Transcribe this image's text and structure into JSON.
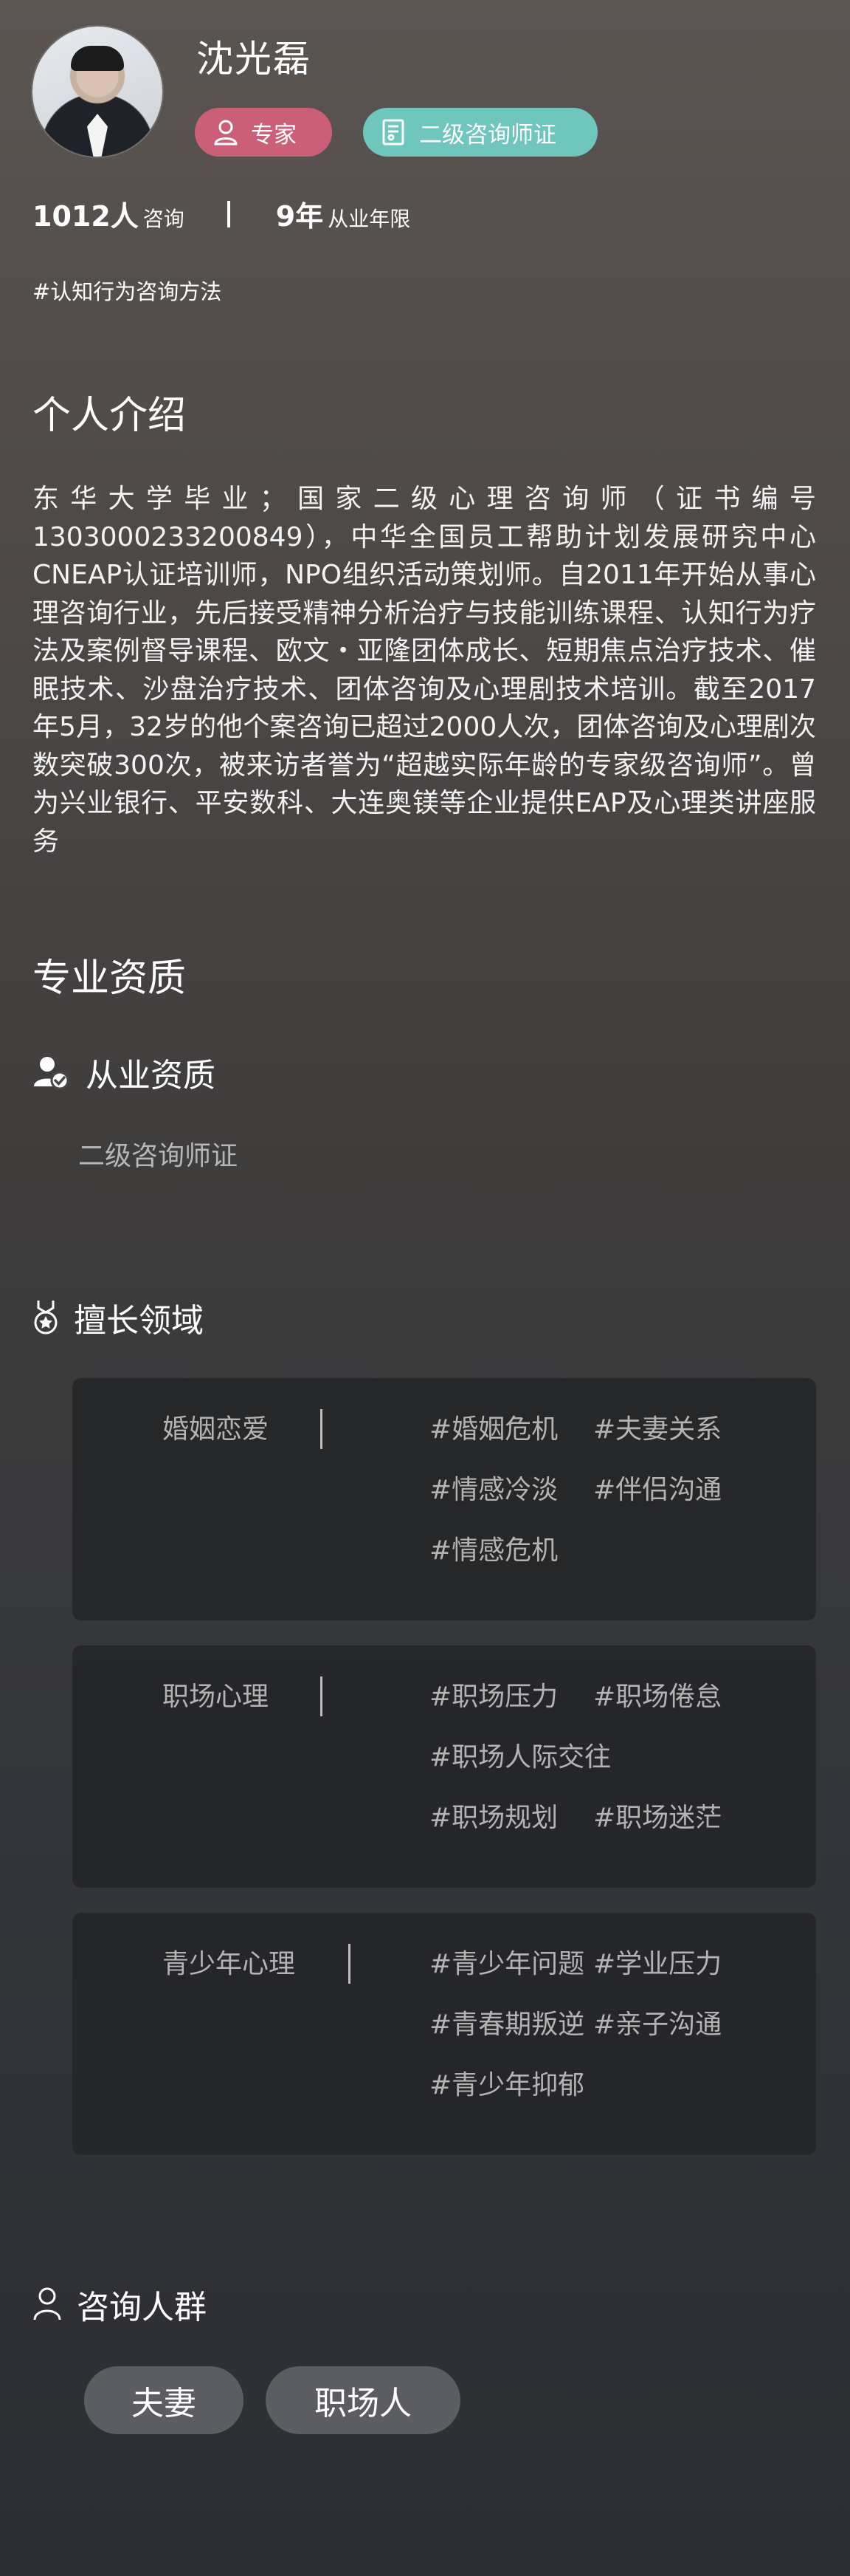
{
  "profile": {
    "name": "沈光磊",
    "badges": [
      "专家",
      "二级咨询师证"
    ],
    "stats": {
      "consult_count": "1012人",
      "consult_label": "咨询",
      "years": "9年",
      "years_label": "从业年限"
    },
    "method": "#认知行为咨询方法"
  },
  "intro": {
    "title": "个人介绍",
    "text": "东华大学毕业；国家二级心理咨询师（证书编号1303000233200849），中华全国员工帮助计划发展研究中心CNEAP认证培训师，NPO组织活动策划师。自2011年开始从事心理咨询行业，先后接受精神分析治疗与技能训练课程、认知行为疗法及案例督导课程、欧文・亚隆团体成长、短期焦点治疗技术、催眠技术、沙盘治疗技术、团体咨询及心理剧技术培训。截至2017年5月，32岁的他个案咨询已超过2000人次，团体咨询及心理剧次数突破300次，被来访者誉为“超越实际年龄的专家级咨询师”。曾为兴业银行、平安数科、大连奥镁等企业提供EAP及心理类讲座服务"
  },
  "qualifications": {
    "title": "专业资质",
    "sub_title": "从业资质",
    "certificate": "二级咨询师证"
  },
  "specialties": {
    "title": "擅长领域",
    "cards": [
      {
        "category": "婚姻恋爱",
        "tags": [
          "#婚姻危机",
          "#夫妻关系",
          "#情感冷淡",
          "#伴侣沟通",
          "#情感危机"
        ]
      },
      {
        "category": "职场心理",
        "tags": [
          "#职场压力",
          "#职场倦怠",
          "#职场人际交往",
          "#职场规划",
          "#职场迷茫"
        ]
      },
      {
        "category": "青少年心理",
        "tags": [
          "#青少年问题",
          "#学业压力",
          "#青春期叛逆",
          "#亲子沟通",
          "#青少年抑郁"
        ]
      }
    ]
  },
  "crowd": {
    "title": "咨询人群",
    "pills": [
      "夫妻",
      "职场人"
    ]
  },
  "colors": {
    "expert_badge": "#cc5f78",
    "cert_badge": "#6ec6bd",
    "card_bg": "#232427",
    "pill_bg": "#5b5d62"
  },
  "icons": [
    "user-icon",
    "certificate-icon",
    "verified-user-icon",
    "medal-icon",
    "person-outline-icon"
  ]
}
